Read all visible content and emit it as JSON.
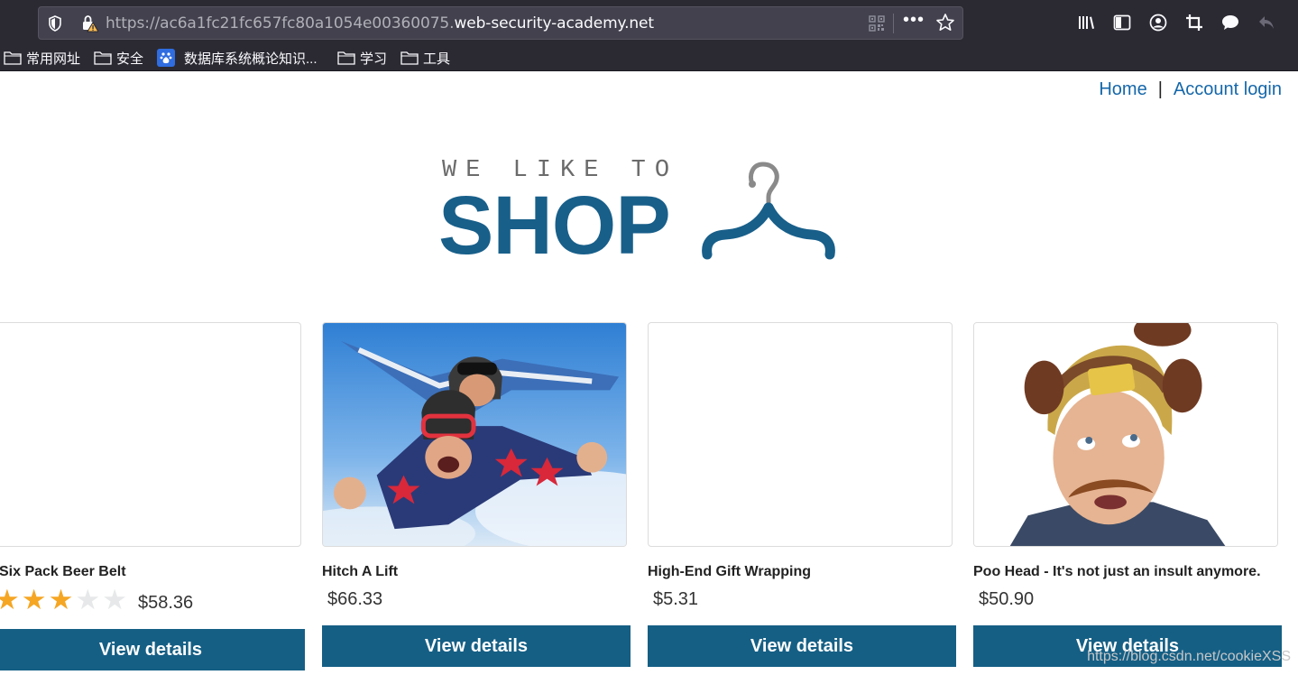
{
  "browser": {
    "url_prefix": "https://ac6a1fc21fc657fc80a1054e00360075.",
    "url_host": "web-security-academy.net",
    "more_label": "•••",
    "bookmarks": [
      {
        "label": "常用网址",
        "icon": "folder-icon"
      },
      {
        "label": "安全",
        "icon": "folder-icon"
      },
      {
        "label": "数据库系统概论知识...",
        "icon": "baidu-icon"
      },
      {
        "label": "学习",
        "icon": "folder-icon"
      },
      {
        "label": "工具",
        "icon": "folder-icon"
      }
    ]
  },
  "nav": {
    "home": "Home",
    "separator": "|",
    "account_login": "Account login"
  },
  "logo": {
    "tagline": "WE LIKE TO",
    "wordmark": "SHOP"
  },
  "colors": {
    "brand": "#185f8a",
    "button": "#155f85",
    "link": "#1567aa",
    "star_on": "#f5a623",
    "star_off": "#e6e8ea"
  },
  "products": [
    {
      "name": "Six Pack Beer Belt",
      "price": "$58.36",
      "rating": 3,
      "rating_max": 5,
      "button": "View details",
      "image": "blank"
    },
    {
      "name": "Hitch A Lift",
      "price": "$66.33",
      "button": "View details",
      "image": "skydivers-photo"
    },
    {
      "name": "High-End Gift Wrapping",
      "price": "$5.31",
      "button": "View details",
      "image": "blank"
    },
    {
      "name": "Poo Head - It's not just an insult anymore.",
      "price": "$50.90",
      "button": "View details",
      "image": "poo-head-photo"
    }
  ],
  "watermark": "https://blog.csdn.net/cookieXSS"
}
